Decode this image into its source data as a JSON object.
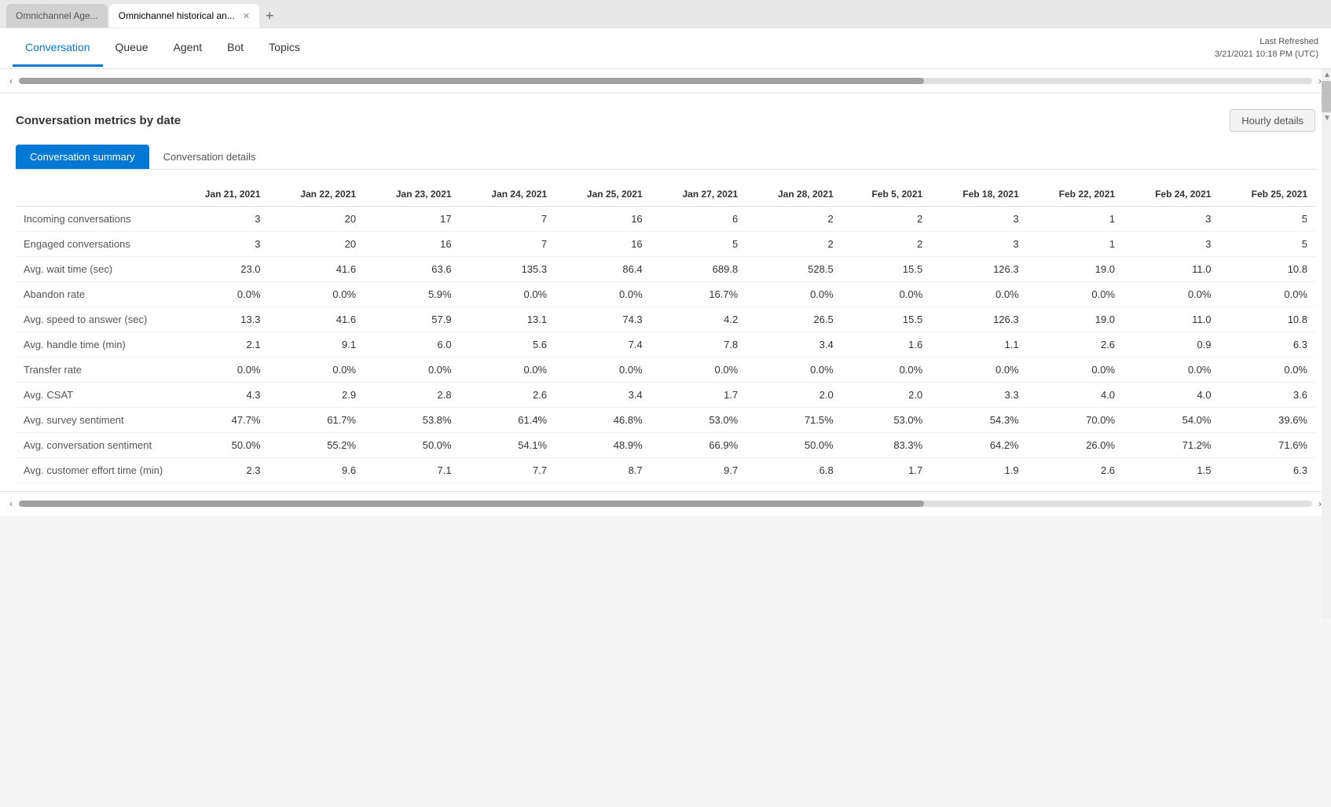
{
  "browser": {
    "tabs": [
      {
        "id": "tab1",
        "label": "Omnichannel Age...",
        "active": false
      },
      {
        "id": "tab2",
        "label": "Omnichannel historical an...",
        "active": true
      }
    ],
    "add_tab_label": "+"
  },
  "header": {
    "nav_tabs": [
      {
        "id": "conversation",
        "label": "Conversation",
        "active": true
      },
      {
        "id": "queue",
        "label": "Queue",
        "active": false
      },
      {
        "id": "agent",
        "label": "Agent",
        "active": false
      },
      {
        "id": "bot",
        "label": "Bot",
        "active": false
      },
      {
        "id": "topics",
        "label": "Topics",
        "active": false
      }
    ],
    "last_refreshed_label": "Last Refreshed",
    "last_refreshed_value": "3/21/2021 10:18 PM (UTC)"
  },
  "section": {
    "title": "Conversation metrics by date",
    "hourly_details_label": "Hourly details",
    "tab_summary_label": "Conversation summary",
    "tab_details_label": "Conversation details"
  },
  "table": {
    "columns": [
      "Jan 21, 2021",
      "Jan 22, 2021",
      "Jan 23, 2021",
      "Jan 24, 2021",
      "Jan 25, 2021",
      "Jan 27, 2021",
      "Jan 28, 2021",
      "Feb 5, 2021",
      "Feb 18, 2021",
      "Feb 22, 2021",
      "Feb 24, 2021",
      "Feb 25, 2021"
    ],
    "rows": [
      {
        "metric": "Incoming conversations",
        "values": [
          "3",
          "20",
          "17",
          "7",
          "16",
          "6",
          "2",
          "2",
          "3",
          "1",
          "3",
          "5"
        ]
      },
      {
        "metric": "Engaged conversations",
        "values": [
          "3",
          "20",
          "16",
          "7",
          "16",
          "5",
          "2",
          "2",
          "3",
          "1",
          "3",
          "5"
        ]
      },
      {
        "metric": "Avg. wait time (sec)",
        "values": [
          "23.0",
          "41.6",
          "63.6",
          "135.3",
          "86.4",
          "689.8",
          "528.5",
          "15.5",
          "126.3",
          "19.0",
          "11.0",
          "10.8"
        ]
      },
      {
        "metric": "Abandon rate",
        "values": [
          "0.0%",
          "0.0%",
          "5.9%",
          "0.0%",
          "0.0%",
          "16.7%",
          "0.0%",
          "0.0%",
          "0.0%",
          "0.0%",
          "0.0%",
          "0.0%"
        ]
      },
      {
        "metric": "Avg. speed to answer (sec)",
        "values": [
          "13.3",
          "41.6",
          "57.9",
          "13.1",
          "74.3",
          "4.2",
          "26.5",
          "15.5",
          "126.3",
          "19.0",
          "11.0",
          "10.8"
        ]
      },
      {
        "metric": "Avg. handle time (min)",
        "values": [
          "2.1",
          "9.1",
          "6.0",
          "5.6",
          "7.4",
          "7.8",
          "3.4",
          "1.6",
          "1.1",
          "2.6",
          "0.9",
          "6.3"
        ]
      },
      {
        "metric": "Transfer rate",
        "values": [
          "0.0%",
          "0.0%",
          "0.0%",
          "0.0%",
          "0.0%",
          "0.0%",
          "0.0%",
          "0.0%",
          "0.0%",
          "0.0%",
          "0.0%",
          "0.0%"
        ]
      },
      {
        "metric": "Avg. CSAT",
        "values": [
          "4.3",
          "2.9",
          "2.8",
          "2.6",
          "3.4",
          "1.7",
          "2.0",
          "2.0",
          "3.3",
          "4.0",
          "4.0",
          "3.6"
        ]
      },
      {
        "metric": "Avg. survey sentiment",
        "values": [
          "47.7%",
          "61.7%",
          "53.8%",
          "61.4%",
          "46.8%",
          "53.0%",
          "71.5%",
          "53.0%",
          "54.3%",
          "70.0%",
          "54.0%",
          "39.6%"
        ]
      },
      {
        "metric": "Avg. conversation sentiment",
        "values": [
          "50.0%",
          "55.2%",
          "50.0%",
          "54.1%",
          "48.9%",
          "66.9%",
          "50.0%",
          "83.3%",
          "64.2%",
          "26.0%",
          "71.2%",
          "71.6%"
        ]
      },
      {
        "metric": "Avg. customer effort time (min)",
        "values": [
          "2.3",
          "9.6",
          "7.1",
          "7.7",
          "8.7",
          "9.7",
          "6.8",
          "1.7",
          "1.9",
          "2.6",
          "1.5",
          "6.3"
        ]
      }
    ]
  }
}
